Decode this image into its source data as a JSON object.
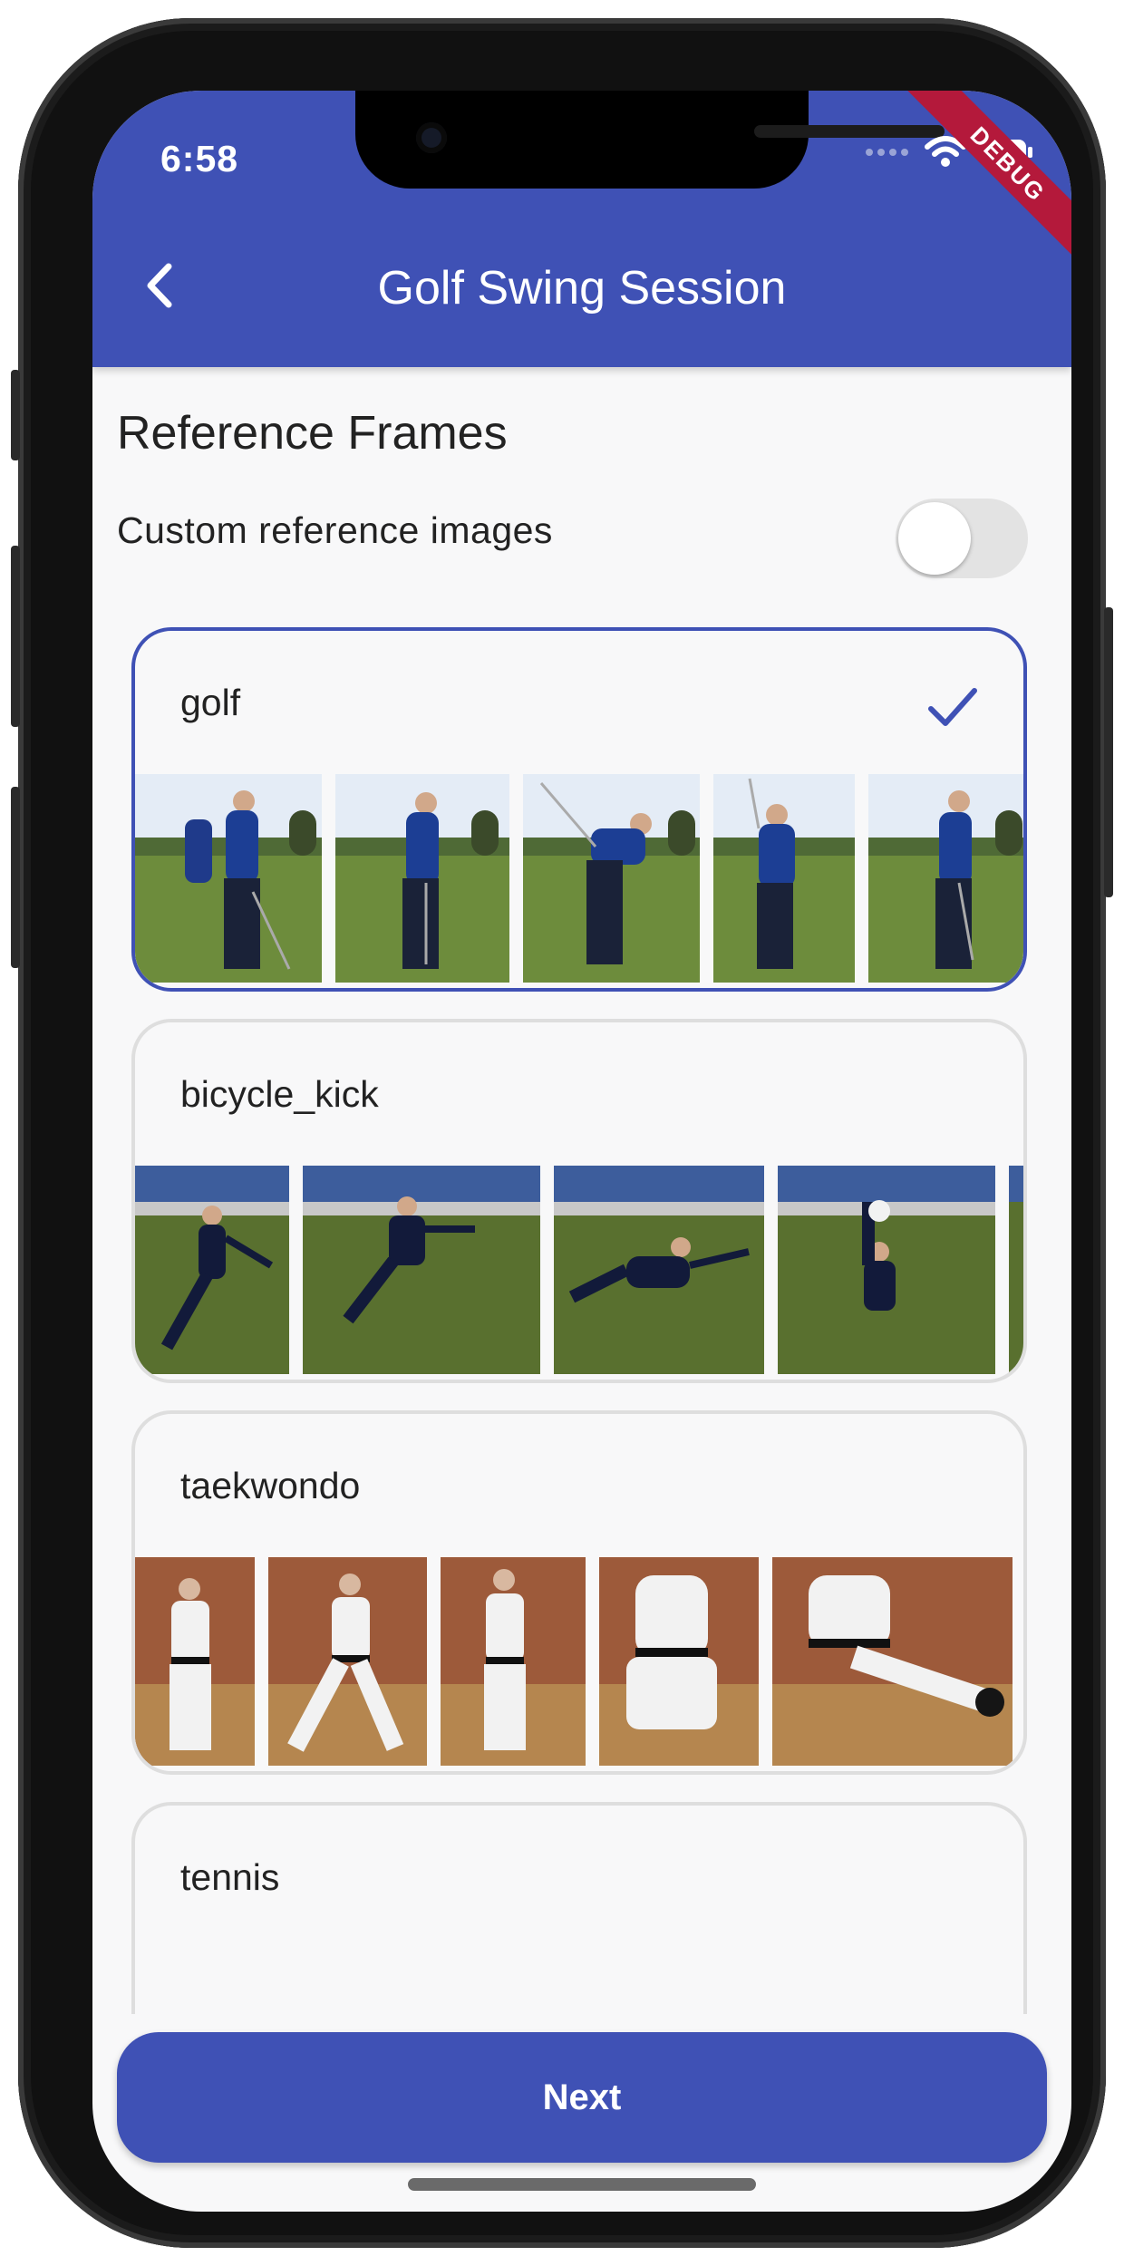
{
  "status_bar": {
    "time": "6:58",
    "debug_label": "DEBUG"
  },
  "app_bar": {
    "title": "Golf Swing Session",
    "back_icon": "chevron-left-icon"
  },
  "section": {
    "title": "Reference Frames"
  },
  "custom_toggle": {
    "label": "Custom reference images",
    "enabled": false
  },
  "reference_sets": [
    {
      "name": "golf",
      "selected": true
    },
    {
      "name": "bicycle_kick",
      "selected": false
    },
    {
      "name": "taekwondo",
      "selected": false
    },
    {
      "name": "tennis",
      "selected": false
    }
  ],
  "next_button": {
    "label": "Next"
  },
  "colors": {
    "primary": "#3f51b5",
    "background": "#f8f8f9",
    "debug_banner": "#b4193b"
  }
}
